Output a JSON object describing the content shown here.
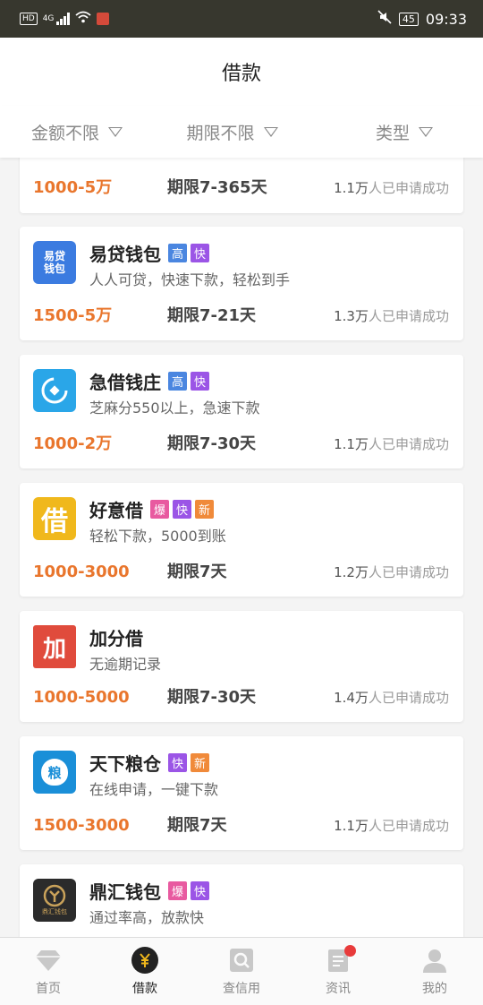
{
  "status_bar": {
    "net_badge": "HD",
    "signal": "4G",
    "battery": "45",
    "time": "09:33"
  },
  "header": {
    "title": "借款"
  },
  "filters": [
    {
      "label": "金额不限"
    },
    {
      "label": "期限不限"
    },
    {
      "label": "类型"
    }
  ],
  "applied_suffix": "人已申请成功",
  "cards": [
    {
      "name": "",
      "desc": "",
      "amount": "1000-5万",
      "term": "期限7-365天",
      "applied": "1.1万"
    },
    {
      "name": "易贷钱包",
      "logo_text": "易贷\n钱包",
      "logo_color": "#3b7be0",
      "tags": [
        "高",
        "快"
      ],
      "desc": "人人可贷，快速下款，轻松到手",
      "amount": "1500-5万",
      "term": "期限7-21天",
      "applied": "1.3万"
    },
    {
      "name": "急借钱庄",
      "logo_text": "",
      "logo_color": "#2aa6e8",
      "tags": [
        "高",
        "快"
      ],
      "desc": "芝麻分550以上，急速下款",
      "amount": "1000-2万",
      "term": "期限7-30天",
      "applied": "1.1万"
    },
    {
      "name": "好意借",
      "logo_text": "借",
      "logo_color": "#f0b81c",
      "tags": [
        "爆",
        "快",
        "新"
      ],
      "desc": "轻松下款，5000到账",
      "amount": "1000-3000",
      "term": "期限7天",
      "applied": "1.2万"
    },
    {
      "name": "加分借",
      "logo_text": "加",
      "logo_color": "#e04b3c",
      "tags": [],
      "desc": "无逾期记录",
      "amount": "1000-5000",
      "term": "期限7-30天",
      "applied": "1.4万"
    },
    {
      "name": "天下粮仓",
      "logo_text": "粮",
      "logo_color": "#1a8fd8",
      "tags": [
        "快",
        "新"
      ],
      "desc": "在线申请，一键下款",
      "amount": "1500-3000",
      "term": "期限7天",
      "applied": "1.1万"
    },
    {
      "name": "鼎汇钱包",
      "logo_text": "鼎汇钱包",
      "logo_color": "#2b2b2b",
      "tags": [
        "爆",
        "快"
      ],
      "desc": "通过率高，放款快",
      "amount": "",
      "term": "",
      "applied": ""
    }
  ],
  "tag_colors": {
    "高": "#4a86e0",
    "快": "#9b55e6",
    "爆": "#e85aa0",
    "新": "#f08a3a"
  },
  "nav": [
    {
      "label": "首页",
      "icon": "diamond-icon"
    },
    {
      "label": "借款",
      "icon": "yen-icon"
    },
    {
      "label": "查信用",
      "icon": "search-icon"
    },
    {
      "label": "资讯",
      "icon": "news-icon"
    },
    {
      "label": "我的",
      "icon": "user-icon"
    }
  ]
}
